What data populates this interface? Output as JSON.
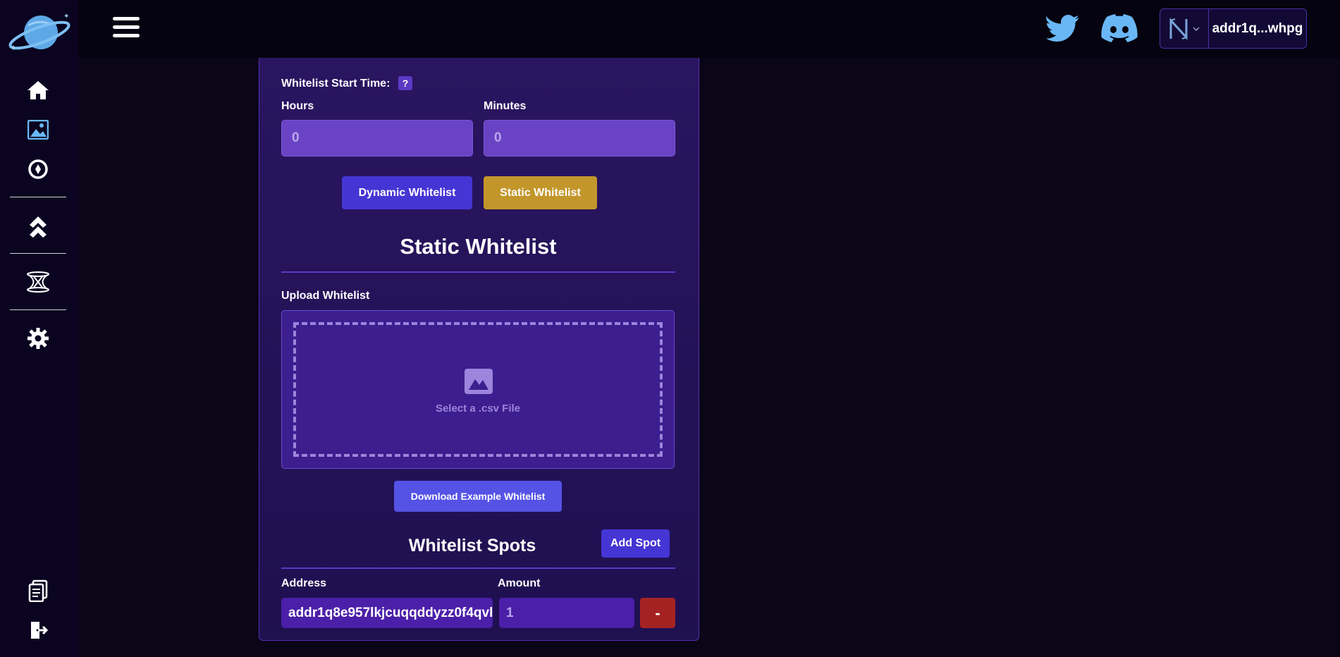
{
  "header": {
    "wallet_address": "addr1q...whpg"
  },
  "form": {
    "whitelist_start_label": "Whitelist Start Time:",
    "help_label": "?",
    "hours_label": "Hours",
    "hours_value": "0",
    "minutes_label": "Minutes",
    "minutes_value": "0",
    "dynamic_whitelist_label": "Dynamic Whitelist",
    "static_whitelist_label": "Static Whitelist",
    "section_title": "Static Whitelist",
    "upload_label": "Upload Whitelist",
    "upload_hint": "Select a .csv File",
    "download_example_label": "Download Example Whitelist",
    "spots_title": "Whitelist Spots",
    "add_spot_label": "Add Spot",
    "address_label": "Address",
    "amount_label": "Amount",
    "address_value": "addr1q8e957lkjcuqqddyzz0f4qvl",
    "amount_value": "1",
    "remove_label": "-"
  },
  "colors": {
    "accent": "#4535d4",
    "static_active": "#c2962a",
    "remove": "#a52222",
    "panel": "#25134f"
  },
  "icons": [
    "planet-logo-icon",
    "menu-icon",
    "home-icon",
    "image-icon",
    "compass-icon",
    "chevrons-up-icon",
    "bridge-icon",
    "gear-icon",
    "documents-icon",
    "logout-icon",
    "twitter-icon",
    "discord-icon",
    "nami-wallet-icon"
  ]
}
